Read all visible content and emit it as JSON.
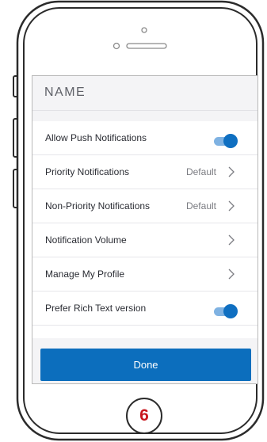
{
  "screen": {
    "title": "NAME"
  },
  "settings": [
    {
      "label": "Allow Push Notifications",
      "control": "toggle",
      "value": "",
      "enabled": true
    },
    {
      "label": "Priority Notifications",
      "control": "chevron",
      "value": "Default"
    },
    {
      "label": "Non-Priority Notifications",
      "control": "chevron",
      "value": "Default"
    },
    {
      "label": "Notification Volume",
      "control": "chevron",
      "value": ""
    },
    {
      "label": "Manage My Profile",
      "control": "chevron",
      "value": ""
    },
    {
      "label": "Prefer Rich Text version",
      "control": "toggle",
      "value": "",
      "enabled": true
    }
  ],
  "done_button": {
    "label": "Done"
  },
  "step_badge": {
    "number": "6"
  },
  "colors": {
    "accent": "#0c6ebd",
    "toggle_knob": "#0f6fc1",
    "toggle_track": "#7fb2e2",
    "step_number": "#c8171e"
  },
  "icons": {
    "chevron": "chevron-right-icon",
    "toggle": "toggle-on"
  }
}
